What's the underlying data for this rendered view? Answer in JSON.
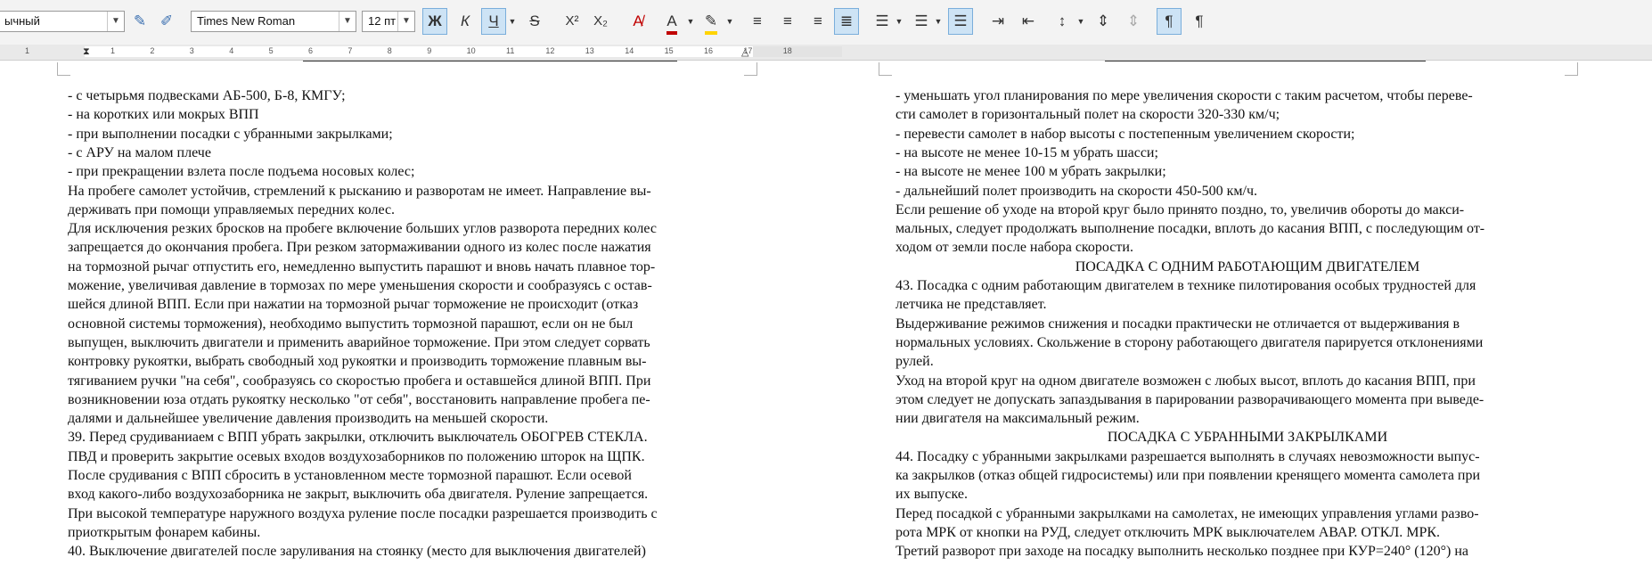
{
  "toolbar": {
    "style_value": "ычный",
    "font_name": "Times New Roman",
    "font_size": "12 пт",
    "buttons": {
      "bold": "Ж",
      "italic": "К",
      "underline": "Ч",
      "strikethrough": "S",
      "superscript": "X²",
      "subscript": "X₂"
    }
  },
  "ruler": {
    "ticks": [
      "1",
      "1",
      "2",
      "3",
      "4",
      "5",
      "6",
      "7",
      "8",
      "9",
      "10",
      "11",
      "12",
      "13",
      "14",
      "15",
      "16",
      "17",
      "18"
    ]
  },
  "left_page": {
    "lines": [
      "- с четырьмя подвесками АБ-500, Б-8, КМГУ;",
      "- на коротких или мокрых ВПП",
      "- при выполнении посадки с убранными закрылками;",
      "- с АРУ на малом плече",
      "- при прекращении взлета после подъема носовых колес;",
      "На пробеге самолет устойчив, стремлений к рысканию и разворотам не имеет. Направление вы-",
      "держивать при помощи управляемых передних колес.",
      "Для исключения резких бросков на пробеге включение больших углов разворота передних колес",
      "запрещается до окончания пробега. При резком затормаживании одного из колес после нажатия",
      "на тормозной рычаг отпустить его, немедленно выпустить парашют и вновь начать плавное тор-",
      "можение, увеличивая давление в тормозах по мере уменьшения скорости и сообразуясь с остав-",
      "шейся длиной ВПП. Если при нажатии на тормозной рычаг торможение не происходит  (отказ",
      "основной системы торможения), необходимо выпустить тормозной парашют, если он не был",
      "выпущен, выключить двигатели и применить аварийное торможение. При этом следует сорвать",
      "контровку рукоятки, выбрать свободный ход рукоятки и производить торможение плавным вы-",
      "тягиванием ручки \"на себя\", сообразуясь со скоростью пробега и оставшейся длиной ВПП. При",
      "возникновении юза отдать рукоятку несколько \"от себя\", восстановить направление пробега пе-",
      "далями и дальнейшее увеличение давления производить на меньшей скорости.",
      "39. Перед срудиваниаем с ВПП убрать закрылки, отключить выключатель ОБОГРЕВ СТЕКЛА.",
      "ПВД и проверить закрытие осевых входов воздухозаборников по положению шторок на ЩПК.",
      "После срудивания с ВПП сбросить в установленном месте тормозной парашют. Если осевой",
      "вход какого-либо воздухозаборника не закрыт, выключить оба двигателя. Руление запрещается.",
      "При высокой температуре наружного воздуха руление после посадки разрешается производить с",
      "приоткрытым фонарем кабины.",
      "40. Выключение двигателей после заруливания на стоянку (место для выключения двигателей)"
    ]
  },
  "right_page": {
    "lines": [
      "- уменьшать угол планирования по мере увеличения скорости с таким расчетом, чтобы переве-",
      "сти самолет в горизонтальный полет на скорости 320-330 км/ч;",
      "- перевести самолет в набор высоты с постепенным увеличением скорости;",
      "- на высоте не менее 10-15 м убрать шасси;",
      "- на высоте не менее 100 м убрать закрылки;",
      "- дальнейший полет производить на скорости 450-500 км/ч.",
      "Если решение об уходе на второй круг было принято поздно, то, увеличив обороты до макси-",
      "мальных, следует продолжать выполнение посадки, вплоть до касания ВПП, с последующим от-",
      "ходом от земли после набора скорости.",
      "ПОСАДКА С ОДНИМ РАБОТАЮЩИМ ДВИГАТЕЛЕМ",
      "43. Посадка с одним работающим двигателем в технике пилотирования особых трудностей для",
      "летчика не представляет.",
      "Выдерживание режимов снижения и посадки практически не отличается от выдерживания в",
      "нормальных условиях. Скольжение в сторону работающего двигателя парируется отклонениями",
      "рулей.",
      "Уход на второй круг на одном двигателе возможен с любых высот, вплоть до касания ВПП, при",
      "этом следует не допускать запаздывания в парировании разворачивающего момента при выведе-",
      "нии двигателя на максимальный режим.",
      "ПОСАДКА С УБРАННЫМИ ЗАКРЫЛКАМИ",
      "44. Посадку с убранными закрылками разрешается выполнять в случаях невозможности выпус-",
      "ка закрылков (отказ общей гидросистемы) или при появлении кренящего момента самолета при",
      "их выпуске.",
      "Перед посадкой с убранными закрылками на самолетах, не имеющих управления углами разво-",
      "рота МРК от кнопки на РУД, следует отключить МРК выключателем АВАР. ОТКЛ. МРК.",
      "Третий разворот при заходе на посадку выполнить несколько позднее при КУР=240° (120°) на"
    ]
  },
  "colors": {
    "font_color": "#c00000",
    "highlight_color": "#ffd400",
    "active_button_bg": "#cde3f5"
  }
}
